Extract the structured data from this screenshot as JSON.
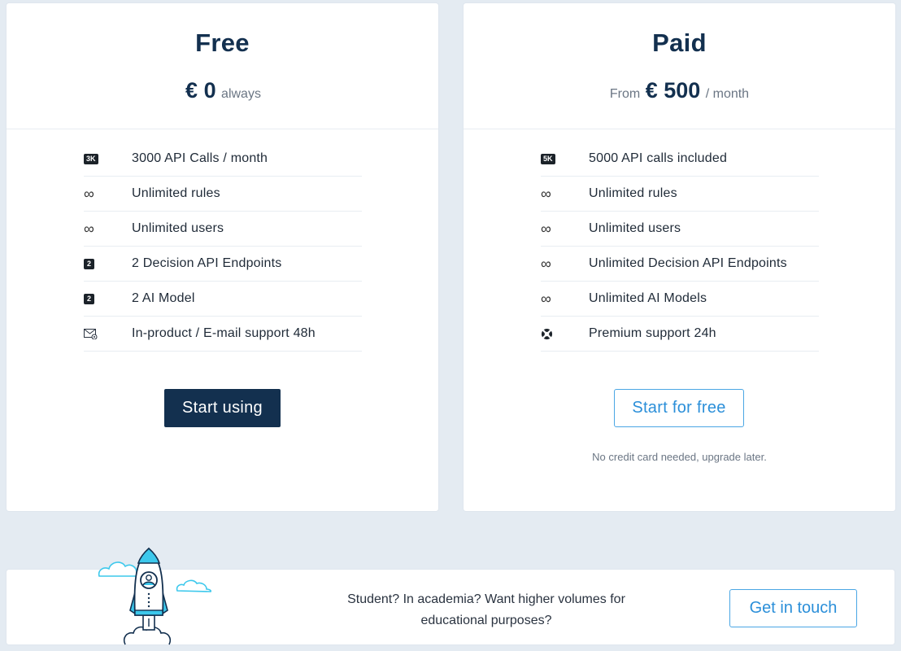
{
  "colors": {
    "background": "#e4ebf2",
    "navy": "#13304f",
    "accent_blue": "#2b8fd9",
    "rocket_cyan": "#3cc8ec"
  },
  "plans": [
    {
      "name": "Free",
      "price_prefix": "",
      "price": "€ 0",
      "price_suffix": "always",
      "features": [
        {
          "icon": "badge-3k-icon",
          "badge": "3K",
          "text": "3000 API Calls / month"
        },
        {
          "icon": "infinity-icon",
          "badge": "∞",
          "text": "Unlimited rules"
        },
        {
          "icon": "infinity-icon",
          "badge": "∞",
          "text": "Unlimited users"
        },
        {
          "icon": "badge-2-icon",
          "badge": "2",
          "text": "2 Decision API Endpoints"
        },
        {
          "icon": "badge-2-icon",
          "badge": "2",
          "text": "2 AI Model"
        },
        {
          "icon": "email-support-icon",
          "badge": "",
          "text": "In-product / E-mail support 48h"
        }
      ],
      "cta_label": "Start using"
    },
    {
      "name": "Paid",
      "price_prefix": "From",
      "price": "€ 500",
      "price_suffix": "/ month",
      "features": [
        {
          "icon": "badge-5k-icon",
          "badge": "5K",
          "text": "5000 API calls included"
        },
        {
          "icon": "infinity-icon",
          "badge": "∞",
          "text": "Unlimited rules"
        },
        {
          "icon": "infinity-icon",
          "badge": "∞",
          "text": "Unlimited users"
        },
        {
          "icon": "infinity-icon",
          "badge": "∞",
          "text": "Unlimited Decision API Endpoints"
        },
        {
          "icon": "infinity-icon",
          "badge": "∞",
          "text": "Unlimited AI Models"
        },
        {
          "icon": "lifebuoy-icon",
          "badge": "",
          "text": "Premium support 24h"
        }
      ],
      "cta_label": "Start for free",
      "note": "No credit card needed, upgrade later."
    }
  ],
  "banner": {
    "icon": "rocket-illustration",
    "text": "Student? In academia? Want higher volumes for educational purposes?",
    "cta_label": "Get in touch"
  }
}
